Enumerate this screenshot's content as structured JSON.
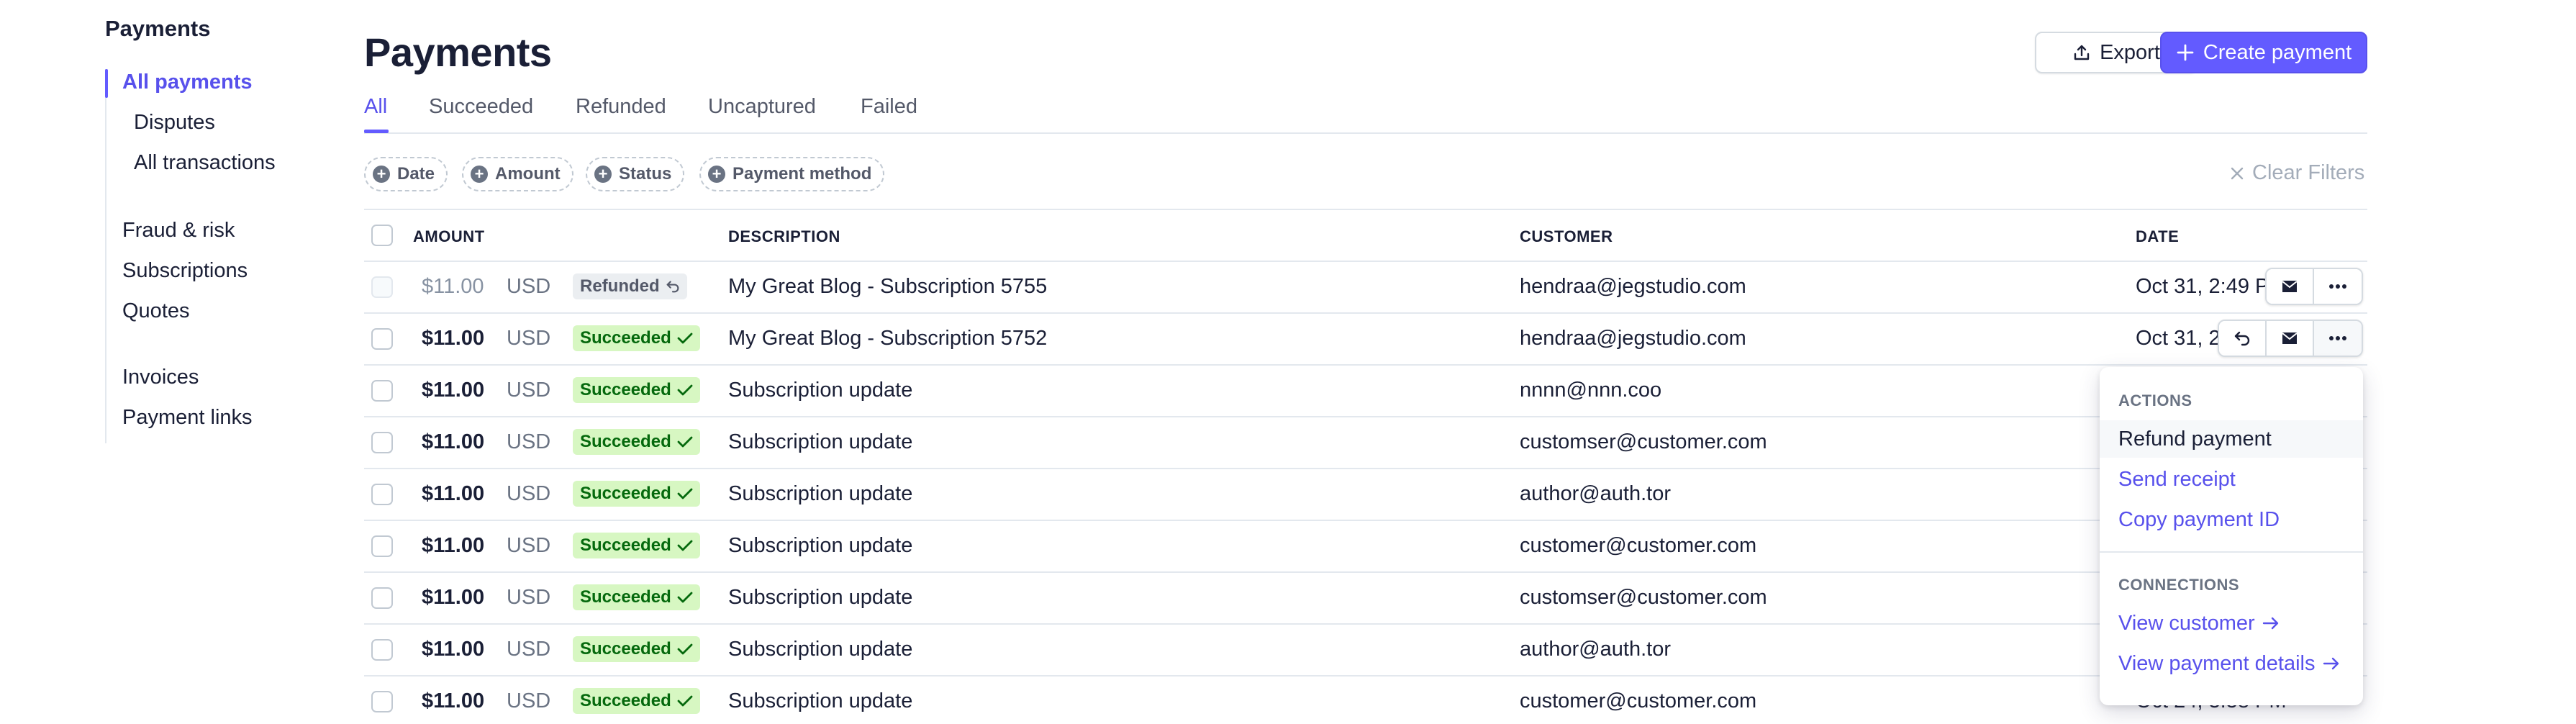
{
  "sidebar": {
    "title": "Payments",
    "items": [
      {
        "label": "All payments",
        "active": true
      },
      {
        "label": "Disputes"
      },
      {
        "label": "All transactions"
      },
      {
        "label": "Fraud & risk"
      },
      {
        "label": "Subscriptions"
      },
      {
        "label": "Quotes"
      },
      {
        "label": "Invoices"
      },
      {
        "label": "Payment links"
      }
    ]
  },
  "header": {
    "title": "Payments",
    "export_label": "Export",
    "create_label": "Create payment"
  },
  "tabs": [
    "All",
    "Succeeded",
    "Refunded",
    "Uncaptured",
    "Failed"
  ],
  "filters": {
    "chips": [
      "Date",
      "Amount",
      "Status",
      "Payment method"
    ],
    "clear_label": "Clear Filters"
  },
  "table": {
    "columns": [
      "AMOUNT",
      "DESCRIPTION",
      "CUSTOMER",
      "DATE"
    ],
    "rows": [
      {
        "amount": "$11.00",
        "currency": "USD",
        "status": "Refunded",
        "description": "My Great Blog - Subscription 5755",
        "customer": "hendraa@jegstudio.com",
        "date": "Oct 31, 2:49 PM"
      },
      {
        "amount": "$11.00",
        "currency": "USD",
        "status": "Succeeded",
        "description": "My Great Blog - Subscription 5752",
        "customer": "hendraa@jegstudio.com",
        "date": "Oct 31, 2"
      },
      {
        "amount": "$11.00",
        "currency": "USD",
        "status": "Succeeded",
        "description": "Subscription update",
        "customer": "nnnn@nnn.coo",
        "date": ""
      },
      {
        "amount": "$11.00",
        "currency": "USD",
        "status": "Succeeded",
        "description": "Subscription update",
        "customer": "customser@customer.com",
        "date": ""
      },
      {
        "amount": "$11.00",
        "currency": "USD",
        "status": "Succeeded",
        "description": "Subscription update",
        "customer": "author@auth.tor",
        "date": ""
      },
      {
        "amount": "$11.00",
        "currency": "USD",
        "status": "Succeeded",
        "description": "Subscription update",
        "customer": "customer@customer.com",
        "date": ""
      },
      {
        "amount": "$11.00",
        "currency": "USD",
        "status": "Succeeded",
        "description": "Subscription update",
        "customer": "customser@customer.com",
        "date": ""
      },
      {
        "amount": "$11.00",
        "currency": "USD",
        "status": "Succeeded",
        "description": "Subscription update",
        "customer": "author@auth.tor",
        "date": ""
      },
      {
        "amount": "$11.00",
        "currency": "USD",
        "status": "Succeeded",
        "description": "Subscription update",
        "customer": "customer@customer.com",
        "date": "Oct 24, 3:58 PM"
      }
    ]
  },
  "menu": {
    "actions_header": "ACTIONS",
    "refund": "Refund payment",
    "send_receipt": "Send receipt",
    "copy_id": "Copy payment ID",
    "connections_header": "CONNECTIONS",
    "view_customer": "View customer",
    "view_details": "View payment details"
  },
  "colors": {
    "accent": "#635bff",
    "success_bg": "#d7f7c2",
    "success_text": "#05690d"
  },
  "icons": [
    "export-icon",
    "plus-icon",
    "close-icon",
    "refund-icon",
    "check-icon",
    "mail-icon",
    "more-icon",
    "arrow-right-icon"
  ]
}
